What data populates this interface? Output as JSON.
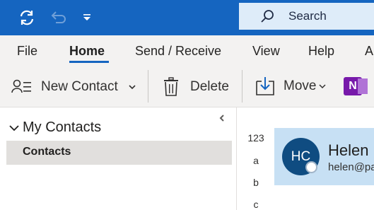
{
  "colors": {
    "accent": "#1565c0",
    "search_bg": "#deecf9",
    "ribbon_bg": "#f3f2f1",
    "selected_folder": "#e1dfdd",
    "selected_card": "#c7e0f4",
    "avatar_bg": "#0f4c81",
    "onenote_purple": "#7719aa"
  },
  "titlebar": {
    "icons": [
      "sync-icon",
      "undo-icon",
      "customize-quick-access-icon"
    ],
    "search_placeholder": "Search"
  },
  "tabs": [
    {
      "label": "File",
      "active": false
    },
    {
      "label": "Home",
      "active": true
    },
    {
      "label": "Send / Receive",
      "active": false
    },
    {
      "label": "View",
      "active": false
    },
    {
      "label": "Help",
      "active": false
    },
    {
      "label": "A",
      "active": false
    }
  ],
  "ribbon": {
    "new_contact": "New Contact",
    "delete": "Delete",
    "move": "Move",
    "onenote_letter": "N",
    "icons": [
      "new-contact-icon",
      "delete-icon",
      "move-icon",
      "onenote-icon"
    ]
  },
  "folder_pane": {
    "group_label": "My Contacts",
    "items": [
      {
        "label": "Contacts",
        "selected": true
      }
    ]
  },
  "alphabet_index": [
    "123",
    "a",
    "b",
    "c"
  ],
  "contact_card": {
    "initials": "HC",
    "name": "Helen",
    "email": "helen@pa"
  }
}
